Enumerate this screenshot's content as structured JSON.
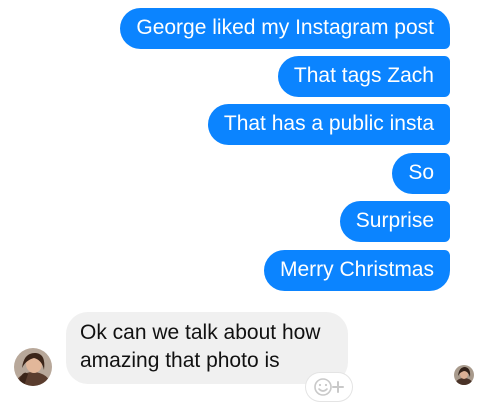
{
  "outgoing_messages": [
    "George liked my Instagram post",
    "That tags Zach",
    "That has a public insta",
    "So",
    "Surprise",
    "Merry Christmas"
  ],
  "incoming_message": {
    "text": "Ok can we talk about how amazing that photo is"
  },
  "icons": {
    "reaction": "smiley-plus-icon",
    "sender_avatar": "avatar",
    "read_receipt": "avatar"
  },
  "colors": {
    "outgoing_bubble": "#0b84ff",
    "incoming_bubble": "#f0f0f0"
  }
}
